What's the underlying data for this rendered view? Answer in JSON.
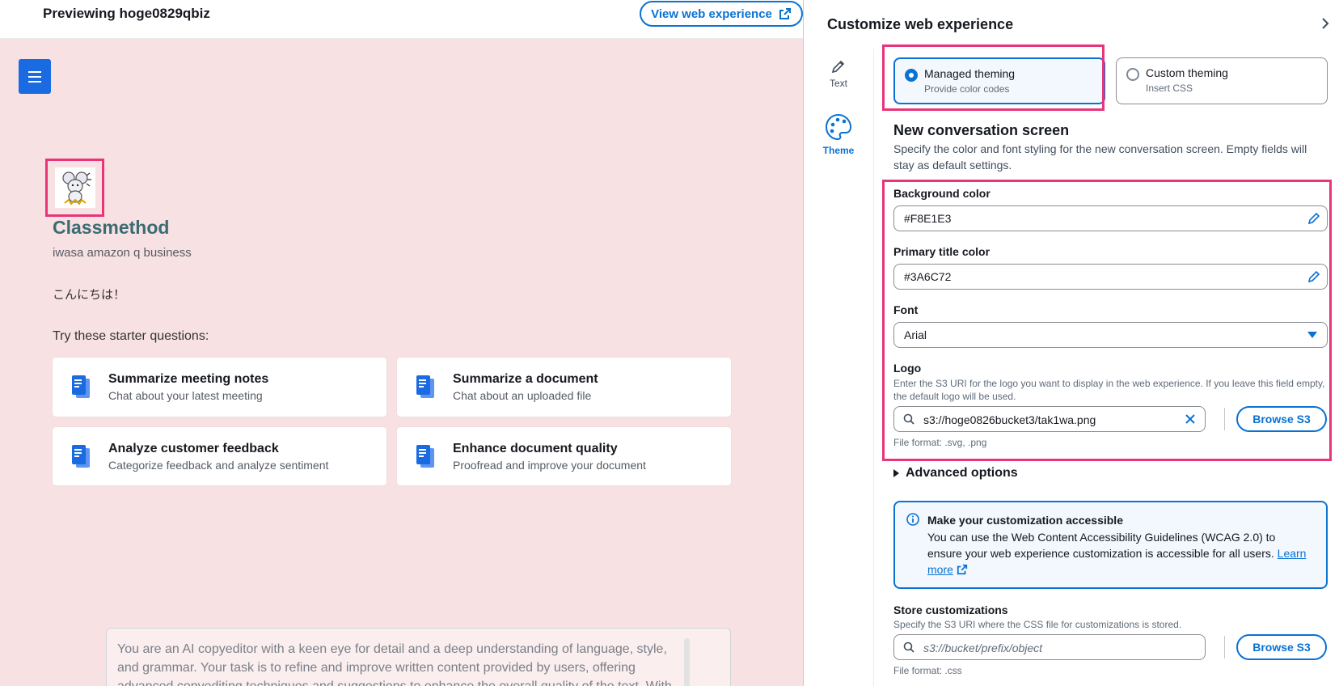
{
  "preview": {
    "title": "Previewing hoge0829qbiz",
    "view_web_label": "View web experience",
    "brand_title": "Classmethod",
    "brand_subtitle": "iwasa amazon q business",
    "greeting": "こんにちは！",
    "starter_label": "Try these starter questions:",
    "cards": [
      {
        "title": "Summarize meeting notes",
        "subtitle": "Chat about your latest meeting"
      },
      {
        "title": "Summarize a document",
        "subtitle": "Chat about an uploaded file"
      },
      {
        "title": "Analyze customer feedback",
        "subtitle": "Categorize feedback and analyze sentiment"
      },
      {
        "title": "Enhance document quality",
        "subtitle": "Proofread and improve your document"
      }
    ],
    "prompt_text": "You are an AI copyeditor with a keen eye for detail and a deep understanding of language, style, and grammar. Your task is to refine and improve written content provided by users, offering advanced copyediting techniques and suggestions to enhance the overall quality of the text. With"
  },
  "panel": {
    "title": "Customize web experience",
    "tabs": {
      "text": "Text",
      "theme": "Theme"
    },
    "theming": {
      "managed": {
        "label": "Managed theming",
        "desc": "Provide color codes"
      },
      "custom": {
        "label": "Custom theming",
        "desc": "Insert CSS"
      }
    },
    "section_title": "New conversation screen",
    "section_desc": "Specify the color and font styling for the new conversation screen. Empty fields will stay as default settings.",
    "bg_color": {
      "label": "Background color",
      "value": "#F8E1E3"
    },
    "title_color": {
      "label": "Primary title color",
      "value": "#3A6C72"
    },
    "font": {
      "label": "Font",
      "value": "Arial"
    },
    "logo": {
      "label": "Logo",
      "desc": "Enter the S3 URI for the logo you want to display in the web experience. If you leave this field empty, the default logo will be used.",
      "value": "s3://hoge0826bucket3/tak1wa.png",
      "browse_label": "Browse S3",
      "format": "File format: .svg, .png"
    },
    "advanced_label": "Advanced options",
    "info": {
      "title": "Make your customization accessible",
      "body": "You can use the Web Content Accessibility Guidelines (WCAG 2.0) to ensure your web experience customization is accessible for all users.",
      "link": "Learn more"
    },
    "store": {
      "label": "Store customizations",
      "desc": "Specify the S3 URI where the CSS file for customizations is stored.",
      "placeholder": "s3://bucket/prefix/object",
      "browse_label": "Browse S3",
      "format": "File format: .css"
    }
  },
  "colors": {
    "preview_bg": "#F8E1E3",
    "primary_title": "#3A6C72",
    "accent": "#0972D3",
    "highlight": "#E8357A"
  }
}
